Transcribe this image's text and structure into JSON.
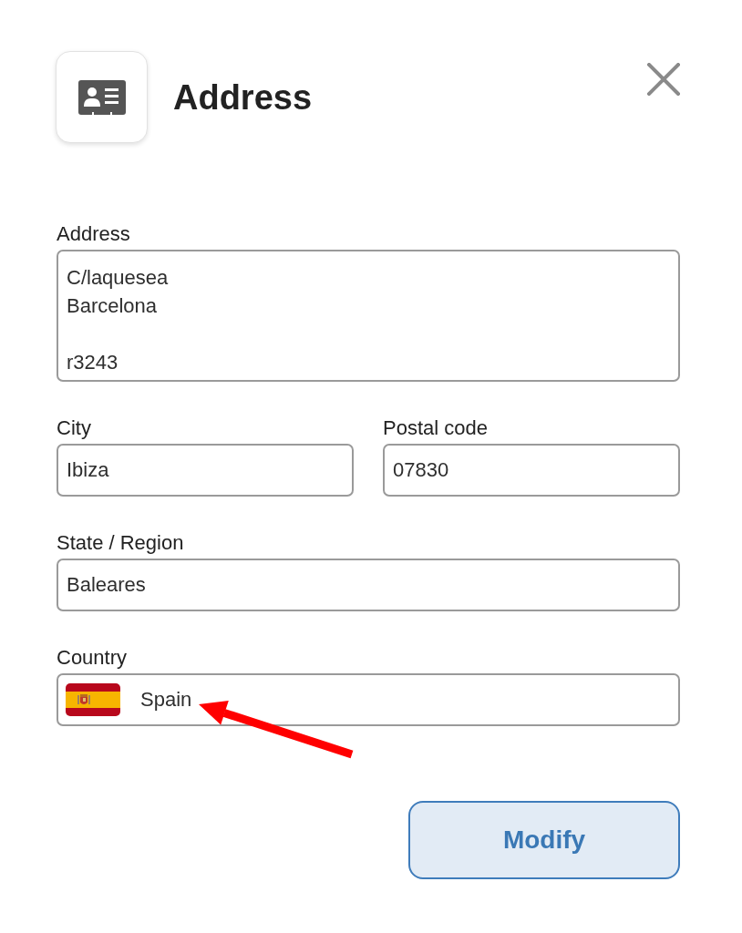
{
  "header": {
    "title": "Address"
  },
  "rows": [
    [
      {
        "kind": "textarea",
        "label": "Address",
        "value": "C/laquesea\nBarcelona\n\nr3243"
      }
    ],
    [
      {
        "kind": "text",
        "label": "City",
        "value": "Ibiza"
      },
      {
        "kind": "text",
        "label": "Postal code",
        "value": "07830"
      }
    ],
    [
      {
        "kind": "text",
        "label": "State / Region",
        "value": "Baleares"
      }
    ],
    [
      {
        "kind": "country",
        "label": "Country",
        "value": "Spain"
      }
    ]
  ],
  "button": {
    "label": "Modify"
  }
}
